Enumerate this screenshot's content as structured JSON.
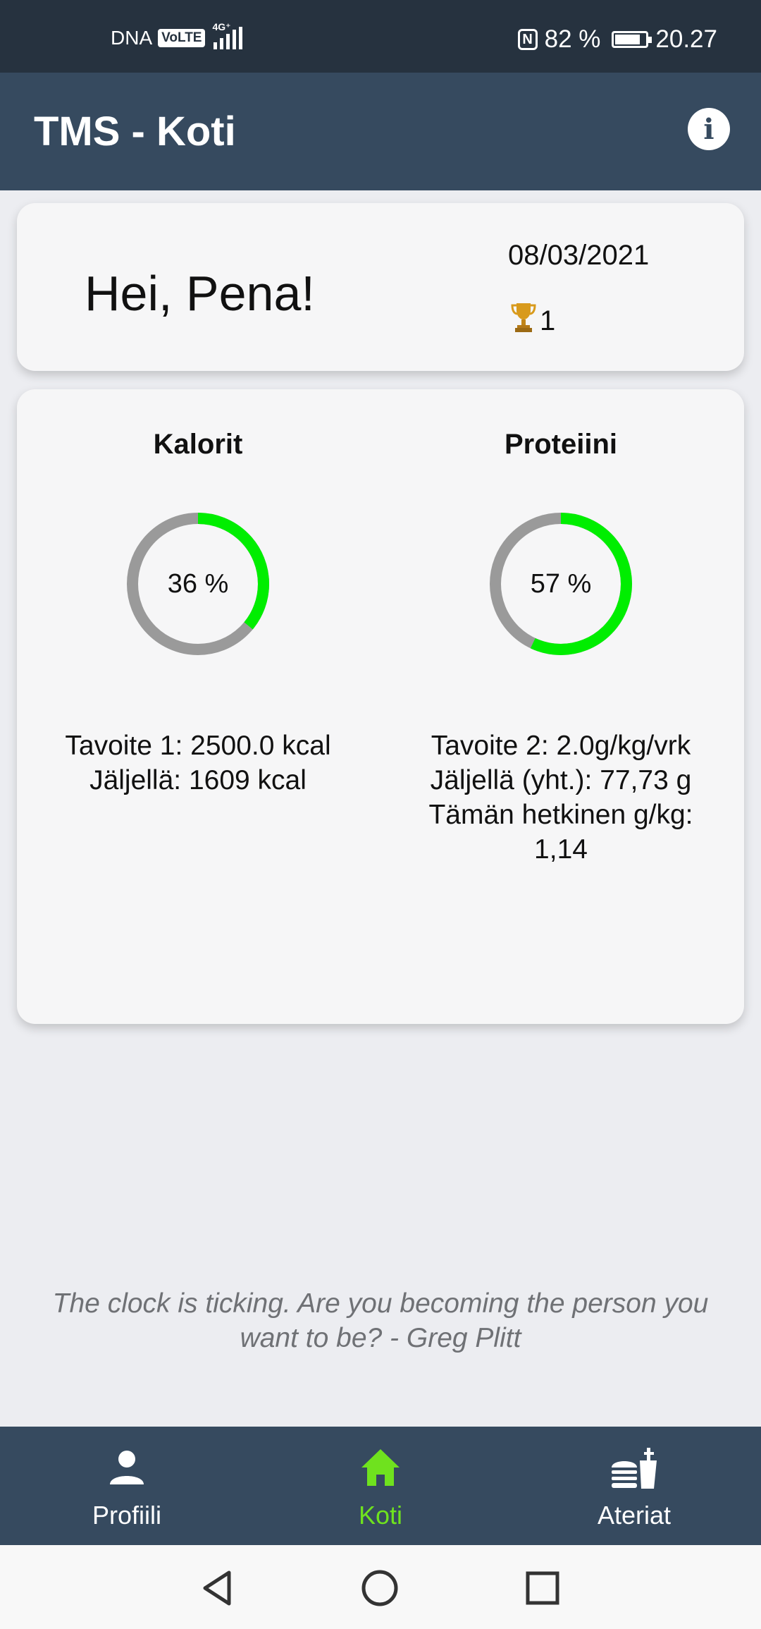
{
  "status_bar": {
    "carrier": "DNA",
    "volte": "VoLTE",
    "network": "4G⁺",
    "nfc": "N",
    "battery_percent": "82 %",
    "time": "20.27"
  },
  "app_bar": {
    "title": "TMS - Koti",
    "info_icon": "info-icon"
  },
  "greeting_card": {
    "greeting": "Hei, Pena!",
    "date": "08/03/2021",
    "trophy_icon": "trophy-icon",
    "trophy_count": "1"
  },
  "stats": {
    "calories": {
      "title": "Kalorit",
      "percent_label": "36 %",
      "progress": 0.36,
      "goal": "Tavoite 1: 2500.0 kcal",
      "remaining": "Jäljellä: 1609 kcal"
    },
    "protein": {
      "title": "Proteiini",
      "percent_label": "57 %",
      "progress": 0.57,
      "goal": "Tavoite 2: 2.0g/kg/vrk",
      "remaining": "Jäljellä (yht.): 77,73 g",
      "current_label": "Tämän hetkinen g/kg:",
      "current_value": "1,14"
    },
    "colors": {
      "progress": "#00ee00",
      "track": "#9a9a9a"
    }
  },
  "quote": "The clock is ticking. Are you becoming the person you want to be? - Greg Plitt",
  "bottom_nav": {
    "items": [
      {
        "label": "Profiili",
        "icon": "person-icon",
        "active": false
      },
      {
        "label": "Koti",
        "icon": "home-icon",
        "active": true
      },
      {
        "label": "Ateriat",
        "icon": "fastfood-icon",
        "active": false
      }
    ],
    "active_color": "#6fe21e"
  },
  "system_nav": {
    "back": "back-icon",
    "home": "home-circle-icon",
    "recents": "recents-icon"
  }
}
